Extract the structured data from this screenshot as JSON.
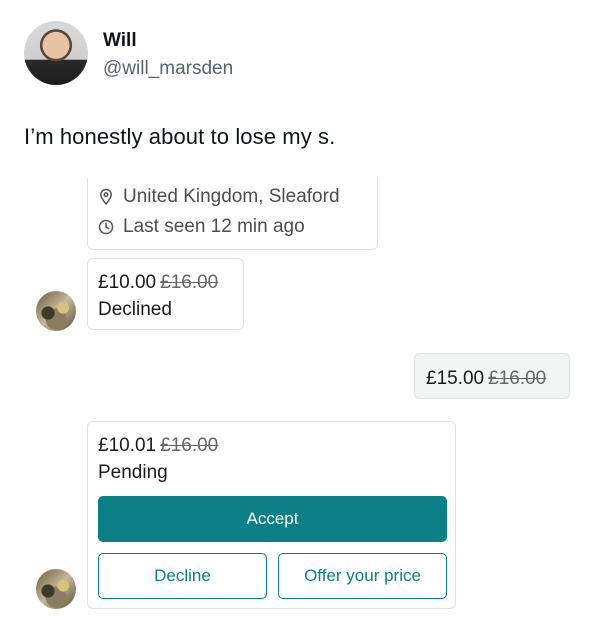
{
  "tweet": {
    "display_name": "Will",
    "handle": "@will_marsden",
    "text": "I’m honestly about to lose my s."
  },
  "seller_info": {
    "location": "United Kingdom, Sleaford",
    "last_seen": "Last seen 12 min ago",
    "location_icon": "location-pin-icon",
    "clock_icon": "clock-icon"
  },
  "messages": [
    {
      "price": "£10.00",
      "original_price": "£16.00",
      "status": "Declined"
    },
    {
      "price": "£15.00",
      "original_price": "£16.00"
    },
    {
      "price": "£10.01",
      "original_price": "£16.00",
      "status": "Pending"
    }
  ],
  "actions": {
    "accept": "Accept",
    "decline": "Decline",
    "offer": "Offer your price"
  },
  "colors": {
    "accent": "#0d7f86",
    "card_border": "#e3e3e3",
    "own_bubble": "#f3f4f4"
  }
}
